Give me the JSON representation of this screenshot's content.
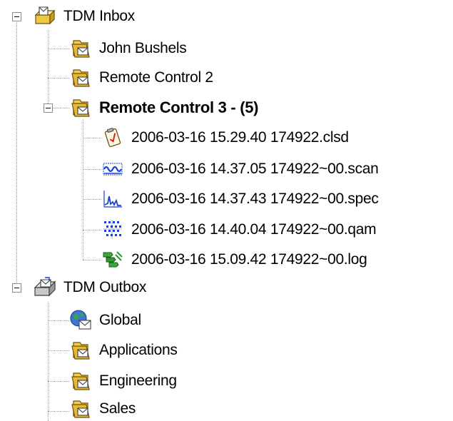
{
  "tree": {
    "inbox": {
      "label": "TDM Inbox",
      "icon": "inbox-tray-icon",
      "children": [
        {
          "label": "John Bushels",
          "icon": "folder-mail-icon"
        },
        {
          "label": "Remote Control 2",
          "icon": "folder-mail-icon"
        },
        {
          "label": "Remote Control 3 - (5)",
          "icon": "folder-mail-icon",
          "bold": true,
          "files": [
            {
              "label": "2006-03-16 15.29.40 174922.clsd",
              "icon": "clipboard-check-icon"
            },
            {
              "label": "2006-03-16 14.37.05 174922~00.scan",
              "icon": "scan-wave-icon"
            },
            {
              "label": "2006-03-16 14.37.43 174922~00.spec",
              "icon": "spectrum-peak-icon"
            },
            {
              "label": "2006-03-16 14.40.04 174922~00.qam",
              "icon": "qam-constellation-icon"
            },
            {
              "label": "2006-03-16 15.09.42 174922~00.log",
              "icon": "log-stack-icon"
            }
          ]
        }
      ]
    },
    "outbox": {
      "label": "TDM Outbox",
      "icon": "outbox-tray-icon",
      "children": [
        {
          "label": "Global",
          "icon": "globe-mail-icon"
        },
        {
          "label": "Applications",
          "icon": "folder-mail-icon"
        },
        {
          "label": "Engineering",
          "icon": "folder-mail-icon"
        },
        {
          "label": "Sales",
          "icon": "folder-mail-icon"
        }
      ]
    }
  },
  "colors": {
    "text": "#000000",
    "tree_line": "#9a9a9a",
    "folder": "#e8c13a",
    "scan_blue": "#1a3fd6",
    "log_green": "#2e9a2e"
  }
}
